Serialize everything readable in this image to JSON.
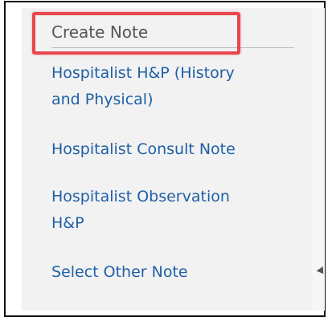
{
  "menu": {
    "header": "Create Note",
    "items": [
      {
        "lines": [
          "Hospitalist H&P (History",
          "and Physical)"
        ]
      },
      {
        "lines": [
          "Hospitalist Consult Note"
        ]
      },
      {
        "lines": [
          "Hospitalist Observation",
          "H&P"
        ]
      },
      {
        "lines": [
          "Select Other Note"
        ]
      }
    ]
  },
  "colors": {
    "highlight_border": "#e8474c",
    "link": "#1f5fa6",
    "panel_background": "#f2f2f2",
    "header_text": "#555555"
  },
  "icons": {
    "scroll": "scroll-down-arrow-icon"
  }
}
